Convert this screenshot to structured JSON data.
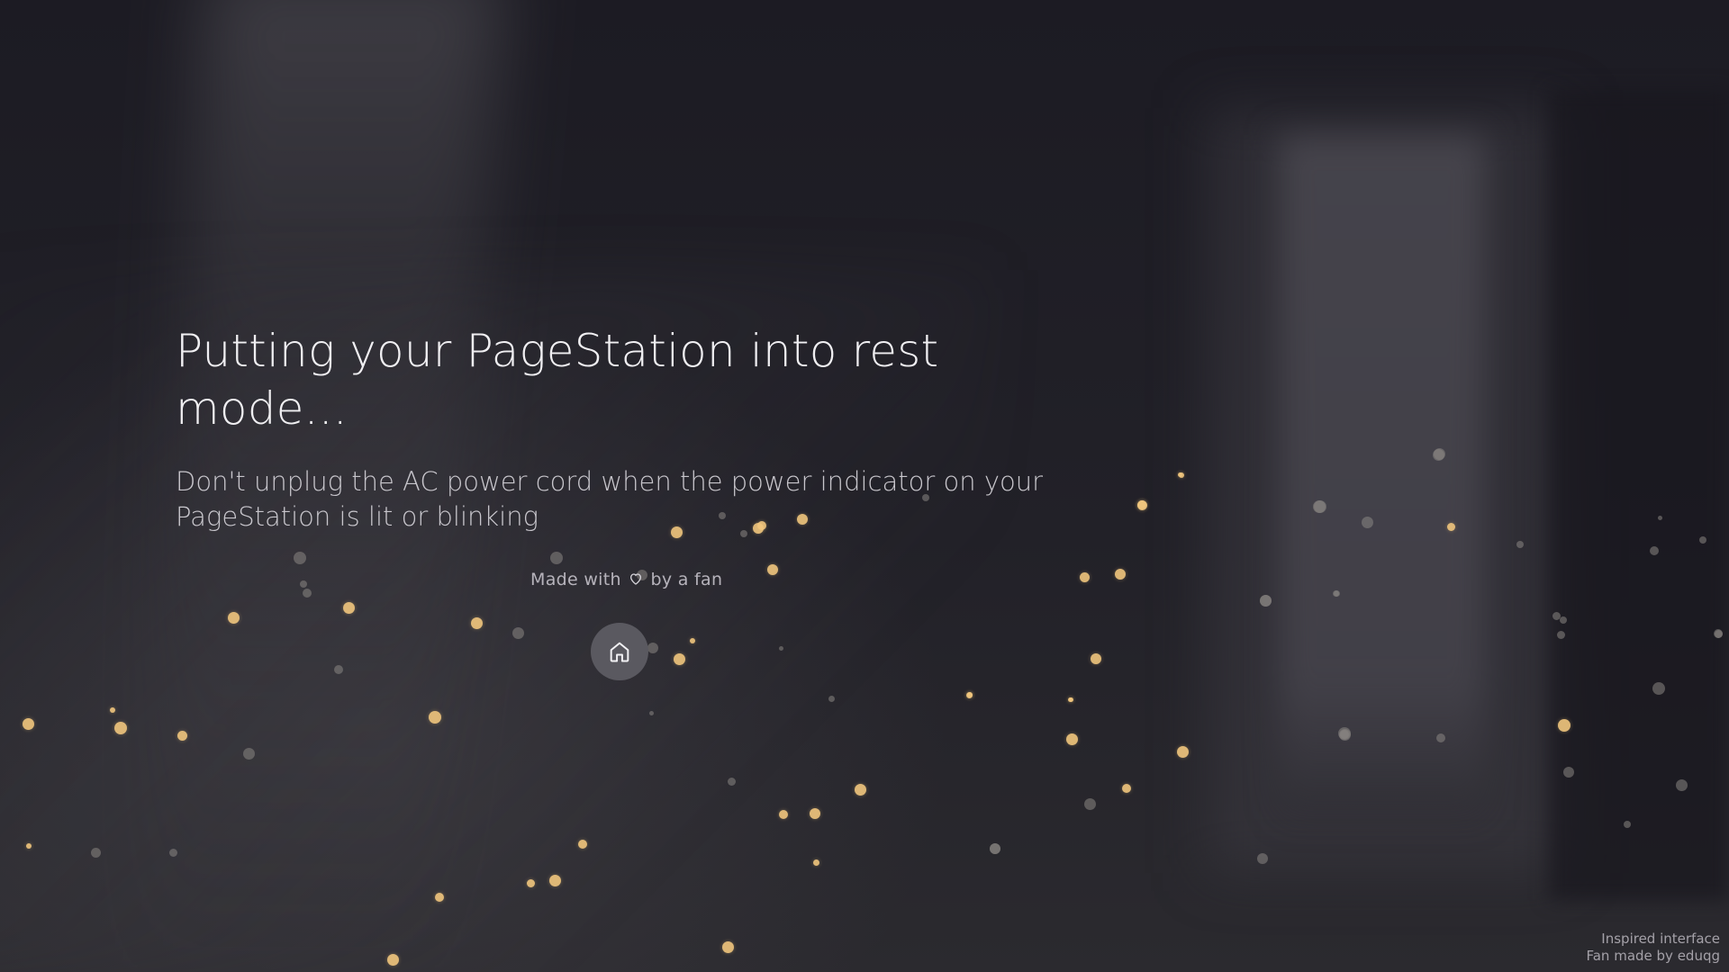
{
  "main": {
    "title": "Putting your PageStation into rest mode...",
    "subtitle": "Don't unplug the AC power cord when the power indicator on your PageStation is lit or blinking"
  },
  "credit": {
    "before": "Made with",
    "after": "by a fan",
    "icon": "heart-icon"
  },
  "home_button": {
    "icon": "home-icon"
  },
  "footer": {
    "line1": "Inspired interface",
    "line2": "Fan made by eduqg"
  },
  "colors": {
    "background": "#1c1b22",
    "particle_gold": "#f2c77e",
    "particle_gray": "#8a8784",
    "button": "#5a5960"
  }
}
